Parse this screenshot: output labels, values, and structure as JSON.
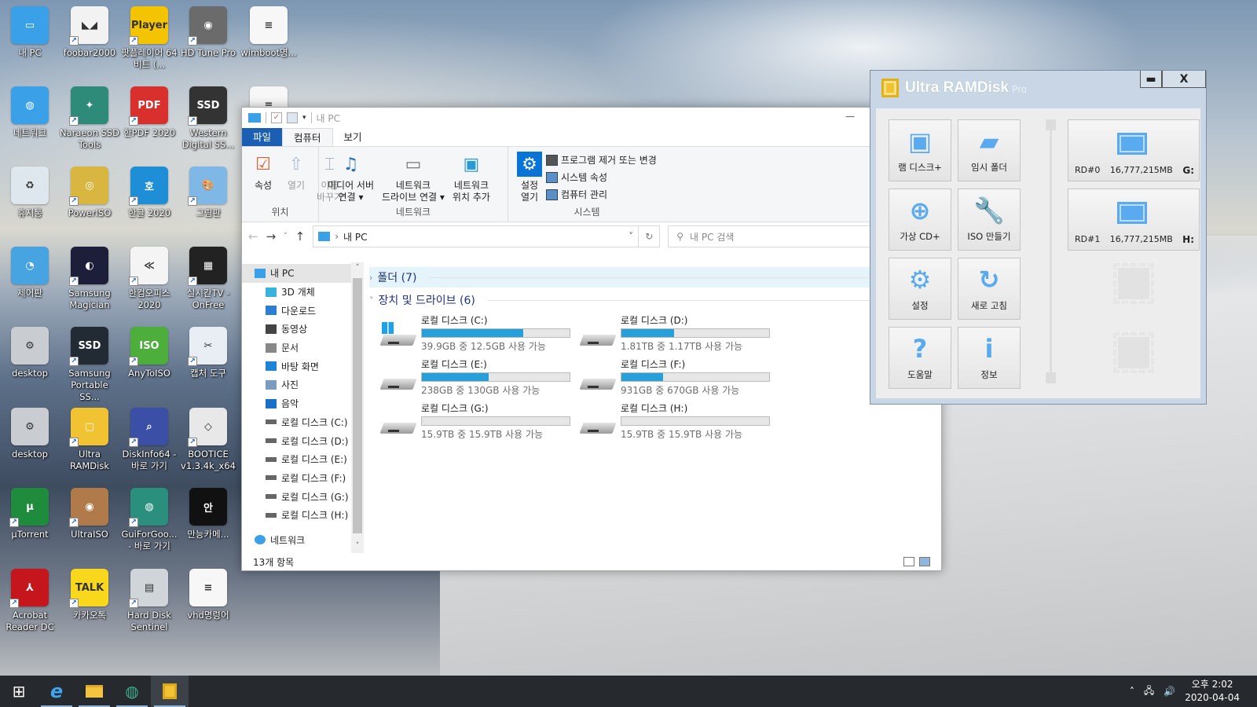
{
  "desktop": {
    "icons": [
      {
        "label": "내 PC",
        "glyph": "▭",
        "color": "#3aa0e8",
        "shortcut": false
      },
      {
        "label": "foobar2000",
        "glyph": "◣◢",
        "color": "#f2f2f2",
        "shortcut": true
      },
      {
        "label": "팟플레이어 64 비트 (...",
        "glyph": "Player",
        "color": "#f5c400",
        "shortcut": true
      },
      {
        "label": "HD Tune Pro",
        "glyph": "◉",
        "color": "#6b6b6b",
        "shortcut": true
      },
      {
        "label": "wimboot명...",
        "glyph": "≡",
        "color": "#f7f7f7",
        "shortcut": false
      },
      {
        "label": "네트워크",
        "glyph": "◍",
        "color": "#3aa0e8",
        "shortcut": false
      },
      {
        "label": "Naraeon SSD Tools",
        "glyph": "✦",
        "color": "#2e8b7a",
        "shortcut": true
      },
      {
        "label": "한PDF 2020",
        "glyph": "PDF",
        "color": "#d9302e",
        "shortcut": true
      },
      {
        "label": "Western Digital SS...",
        "glyph": "SSD",
        "color": "#333333",
        "shortcut": true
      },
      {
        "label": "",
        "glyph": "≡",
        "color": "#f7f7f7",
        "shortcut": false
      },
      {
        "label": "휴지통",
        "glyph": "♻",
        "color": "#dfe7ee",
        "shortcut": false
      },
      {
        "label": "PowerISO",
        "glyph": "◎",
        "color": "#d8b640",
        "shortcut": true
      },
      {
        "label": "한글 2020",
        "glyph": "호",
        "color": "#1e8fd6",
        "shortcut": true
      },
      {
        "label": "그림판",
        "glyph": "🎨",
        "color": "#7fb8e6",
        "shortcut": true
      },
      {
        "label": "제어판",
        "glyph": "◔",
        "color": "#47a4e0",
        "shortcut": false
      },
      {
        "label": "Samsung Magician",
        "glyph": "◐",
        "color": "#1d1f3a",
        "shortcut": true
      },
      {
        "label": "한컴오피스 2020",
        "glyph": "≪",
        "color": "#f4f4f4",
        "shortcut": true
      },
      {
        "label": "실시간TV - OnFree",
        "glyph": "▦",
        "color": "#222222",
        "shortcut": true
      },
      {
        "label": "desktop",
        "glyph": "⚙",
        "color": "#c9cdd2",
        "shortcut": false
      },
      {
        "label": "Samsung Portable SS...",
        "glyph": "SSD",
        "color": "#222a33",
        "shortcut": true
      },
      {
        "label": "AnyToISO",
        "glyph": "ISO",
        "color": "#4dae3c",
        "shortcut": true
      },
      {
        "label": "캡처 도구",
        "glyph": "✂",
        "color": "#e9eef4",
        "shortcut": true
      },
      {
        "label": "desktop",
        "glyph": "⚙",
        "color": "#c9cdd2",
        "shortcut": false
      },
      {
        "label": "Ultra RAMDisk",
        "glyph": "▢",
        "color": "#f1c232",
        "shortcut": true
      },
      {
        "label": "DiskInfo64 - 바로 가기",
        "glyph": "⌕",
        "color": "#3b4fa6",
        "shortcut": true
      },
      {
        "label": "BOOTICE v1.3.4k_x64",
        "glyph": "◇",
        "color": "#e8e8e8",
        "shortcut": true
      },
      {
        "label": "µTorrent",
        "glyph": "µ",
        "color": "#1f8b3c",
        "shortcut": true
      },
      {
        "label": "UltraISO",
        "glyph": "◉",
        "color": "#b07a4a",
        "shortcut": true
      },
      {
        "label": "GuiForGoo... - 바로 가기",
        "glyph": "◍",
        "color": "#2a8f7c",
        "shortcut": true
      },
      {
        "label": "만능카메...",
        "glyph": "안",
        "color": "#111111",
        "shortcut": false
      },
      {
        "label": "Acrobat Reader DC",
        "glyph": "⅄",
        "color": "#c4161c",
        "shortcut": true
      },
      {
        "label": "카카오톡",
        "glyph": "TALK",
        "color": "#f9d71c",
        "shortcut": true
      },
      {
        "label": "Hard Disk Sentinel",
        "glyph": "▤",
        "color": "#cfd5d9",
        "shortcut": true
      },
      {
        "label": "vhd명령어",
        "glyph": "≡",
        "color": "#f7f7f7",
        "shortcut": false
      }
    ]
  },
  "explorer": {
    "title": "내 PC",
    "tabs": [
      "파일",
      "컴퓨터",
      "보기"
    ],
    "active_tab": "컴퓨터",
    "ribbon": {
      "location": {
        "label": "위치",
        "buttons": [
          "속성",
          "열기",
          "이름\n바꾸기"
        ]
      },
      "network": {
        "label": "네트워크",
        "buttons": [
          "미디어 서버\n연결 ▾",
          "네트워크\n드라이브 연결 ▾",
          "네트워크\n위치 추가"
        ]
      },
      "system": {
        "label": "시스템",
        "settings": "설정\n열기",
        "items": [
          "프로그램 제거 또는 변경",
          "시스템 속성",
          "컴퓨터 관리"
        ]
      }
    },
    "address": {
      "path": "내 PC",
      "search_placeholder": "내 PC 검색"
    },
    "nav": {
      "root": "내 PC",
      "items": [
        "3D 개체",
        "다운로드",
        "동영상",
        "문서",
        "바탕 화면",
        "사진",
        "음악",
        "로컬 디스크 (C:)",
        "로컬 디스크 (D:)",
        "로컬 디스크 (E:)",
        "로컬 디스크 (F:)",
        "로컬 디스크 (G:)",
        "로컬 디스크 (H:)"
      ],
      "network": "네트워크"
    },
    "sections": {
      "folders": "폴더 (7)",
      "drives": "장치 및 드라이브 (6)"
    },
    "drives": [
      {
        "name": "로컬 디스크 (C:)",
        "free_text": "39.9GB 중 12.5GB 사용 가능",
        "used_fraction": 0.687,
        "system": true
      },
      {
        "name": "로컬 디스크 (D:)",
        "free_text": "1.81TB 중 1.17TB 사용 가능",
        "used_fraction": 0.354,
        "system": false
      },
      {
        "name": "로컬 디스크 (E:)",
        "free_text": "238GB 중 130GB 사용 가능",
        "used_fraction": 0.454,
        "system": false
      },
      {
        "name": "로컬 디스크 (F:)",
        "free_text": "931GB 중 670GB 사용 가능",
        "used_fraction": 0.28,
        "system": false
      },
      {
        "name": "로컬 디스크 (G:)",
        "free_text": "15.9TB 중 15.9TB 사용 가능",
        "used_fraction": 0,
        "system": false
      },
      {
        "name": "로컬 디스크 (H:)",
        "free_text": "15.9TB 중 15.9TB 사용 가능",
        "used_fraction": 0,
        "system": false
      }
    ],
    "status": "13개 항목",
    "bar_color": "#26a0da"
  },
  "ramdisk": {
    "title": "Ultra RAMDisk",
    "edition": "Pro",
    "minimize": "▬",
    "close": "X",
    "buttons": [
      {
        "label": "램 디스크+",
        "icon": "ram-disk-add-icon",
        "glyph": "▣"
      },
      {
        "label": "임시 폴더",
        "icon": "temp-folder-icon",
        "glyph": "▰"
      },
      {
        "label": "가상 CD+",
        "icon": "virtual-cd-icon",
        "glyph": "⊕"
      },
      {
        "label": "ISO 만들기",
        "icon": "wrench-icon",
        "glyph": "🔧"
      },
      {
        "label": "설정",
        "icon": "gear-icon",
        "glyph": "⚙"
      },
      {
        "label": "새로 고침",
        "icon": "refresh-icon",
        "glyph": "↻"
      },
      {
        "label": "도움말",
        "icon": "help-icon",
        "glyph": "?"
      },
      {
        "label": "정보",
        "icon": "info-icon",
        "glyph": "i"
      }
    ],
    "disks": [
      {
        "id": "RD#0",
        "size": "16,777,215MB",
        "letter": "G:"
      },
      {
        "id": "RD#1",
        "size": "16,777,215MB",
        "letter": "H:"
      }
    ],
    "accent": "#5aaaf0"
  },
  "taskbar": {
    "items": [
      {
        "name": "start",
        "glyph": "⊞"
      },
      {
        "name": "internet-explorer",
        "glyph": "e"
      },
      {
        "name": "file-explorer",
        "glyph": "▬"
      },
      {
        "name": "guiforgoo",
        "glyph": "◍"
      },
      {
        "name": "ultra-ramdisk",
        "glyph": "▢"
      }
    ],
    "time": "오후 2:02",
    "date": "2020-04-04"
  }
}
